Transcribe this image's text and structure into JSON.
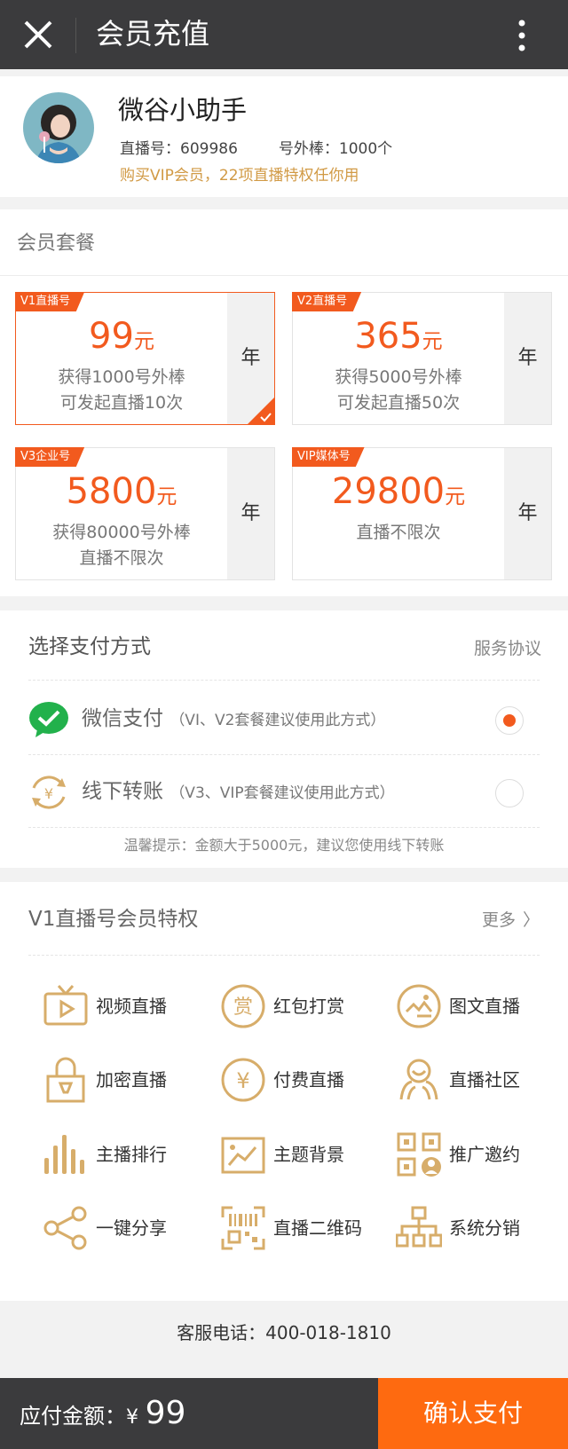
{
  "header": {
    "title": "会员充值"
  },
  "profile": {
    "name": "微谷小助手",
    "live_id": "直播号：609986",
    "sticks": "号外棒：1000个",
    "promo": "购买VIP会员，22项直播特权任你用"
  },
  "packages": {
    "title": "会员套餐",
    "items": [
      {
        "tag": "V1直播号",
        "price": "99",
        "unit": "元",
        "desc1": "获得1000号外棒",
        "desc2": "可发起直播10次",
        "period": "年",
        "selected": true
      },
      {
        "tag": "V2直播号",
        "price": "365",
        "unit": "元",
        "desc1": "获得5000号外棒",
        "desc2": "可发起直播50次",
        "period": "年",
        "selected": false
      },
      {
        "tag": "V3企业号",
        "price": "5800",
        "unit": "元",
        "desc1": "获得80000号外棒",
        "desc2": "直播不限次",
        "period": "年",
        "selected": false
      },
      {
        "tag": "VIP媒体号",
        "price": "29800",
        "unit": "元",
        "desc1": "直播不限次",
        "desc2": "",
        "period": "年",
        "selected": false
      }
    ]
  },
  "payment": {
    "title": "选择支付方式",
    "agreement": "服务协议",
    "methods": [
      {
        "name": "微信支付",
        "note": "（VI、V2套餐建议使用此方式）",
        "icon": "wechat-pay-icon",
        "selected": true
      },
      {
        "name": "线下转账",
        "note": "（V3、VIP套餐建议使用此方式）",
        "icon": "transfer-icon",
        "selected": false
      }
    ],
    "tip": "温馨提示：金额大于5000元，建议您使用线下转账"
  },
  "privileges": {
    "title": "V1直播号会员特权",
    "more": "更多",
    "items": [
      {
        "label": "视频直播",
        "icon": "tv-icon"
      },
      {
        "label": "红包打赏",
        "icon": "reward-icon"
      },
      {
        "label": "图文直播",
        "icon": "image-text-icon"
      },
      {
        "label": "加密直播",
        "icon": "lock-icon"
      },
      {
        "label": "付费直播",
        "icon": "yen-icon"
      },
      {
        "label": "直播社区",
        "icon": "community-icon"
      },
      {
        "label": "主播排行",
        "icon": "ranking-icon"
      },
      {
        "label": "主题背景",
        "icon": "theme-icon"
      },
      {
        "label": "推广邀约",
        "icon": "qrcode-user-icon"
      },
      {
        "label": "一键分享",
        "icon": "share-icon"
      },
      {
        "label": "直播二维码",
        "icon": "qrcode-icon"
      },
      {
        "label": "系统分销",
        "icon": "distribution-icon"
      }
    ]
  },
  "service": "客服电话：400-018-1810",
  "footer": {
    "amount_label": "应付金额：",
    "currency": "¥",
    "amount": "99",
    "confirm": "确认支付"
  },
  "colors": {
    "accent": "#f25a1e",
    "gold": "#d7ad6a",
    "bar": "#3b3b3d",
    "confirm": "#fe6a10"
  }
}
